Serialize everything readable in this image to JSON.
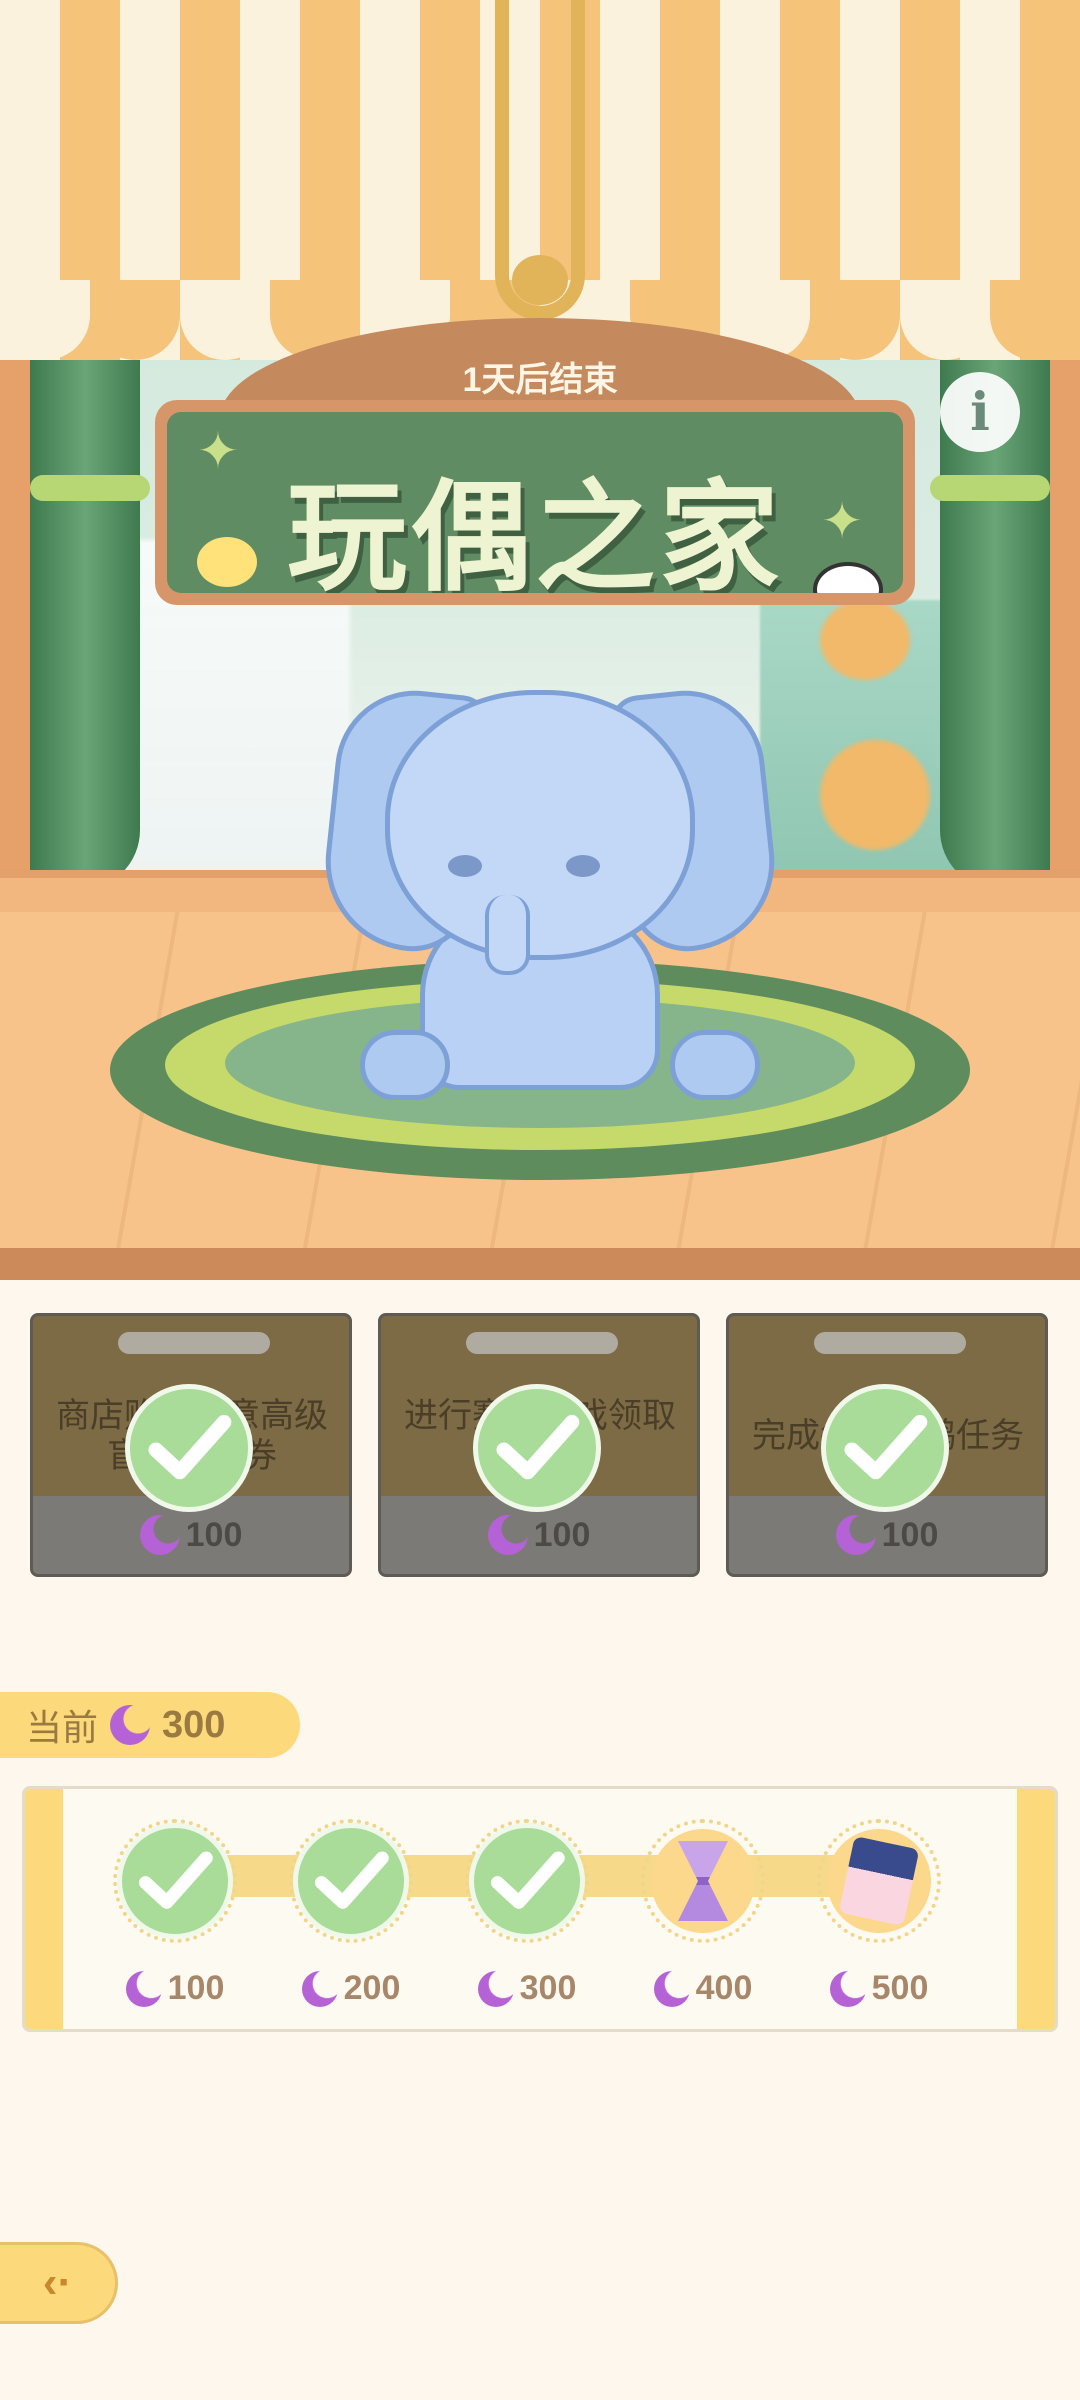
{
  "event": {
    "timer_text": "1天后结束",
    "title": "玩偶之家"
  },
  "tasks": [
    {
      "text": "商店购买任意高级盲盒兑换券",
      "reward": "100",
      "completed": true
    },
    {
      "text": "进行赛马游戏领取一",
      "reward": "100",
      "completed": true
    },
    {
      "text": "完成每日鸽鸽任务",
      "reward": "100",
      "completed": true
    }
  ],
  "current": {
    "label": "当前",
    "value": "300"
  },
  "milestones": [
    {
      "reward": "100",
      "state": "claimed",
      "icon": "check-icon"
    },
    {
      "reward": "200",
      "state": "claimed",
      "icon": "check-icon"
    },
    {
      "reward": "300",
      "state": "claimed",
      "icon": "check-icon"
    },
    {
      "reward": "400",
      "state": "locked",
      "icon": "hourglass-icon"
    },
    {
      "reward": "500",
      "state": "locked",
      "icon": "ticket-icon"
    }
  ],
  "currency_icon": "moon-icon",
  "colors": {
    "accent_yellow": "#fcd97a",
    "check_green": "#a8dc98",
    "moon_purple": "#b562d6",
    "sign_green": "#5f8c63"
  }
}
